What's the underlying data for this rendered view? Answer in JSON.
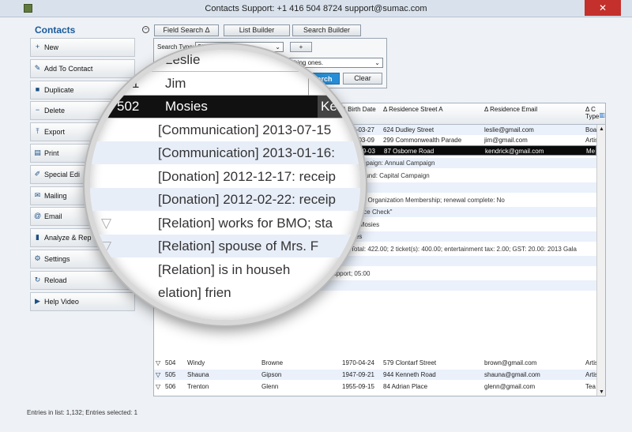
{
  "window": {
    "title": "Contacts      Support: +1 416 504 8724  support@sumac.com",
    "close_label": "✕"
  },
  "sidebar": {
    "title": "Contacts",
    "items": [
      {
        "label": "New",
        "icon": "plus-icon",
        "glyph": "+"
      },
      {
        "label": "Add To Contact",
        "icon": "pencil-icon",
        "glyph": "✎"
      },
      {
        "label": "Duplicate",
        "icon": "duplicate-icon",
        "glyph": "■"
      },
      {
        "label": "Delete",
        "icon": "minus-circle-icon",
        "glyph": "−"
      },
      {
        "label": "Export",
        "icon": "export-icon",
        "glyph": "⤒"
      },
      {
        "label": "Print",
        "icon": "printer-icon",
        "glyph": "▤"
      },
      {
        "label": "Special Edi",
        "icon": "special-edit-icon",
        "glyph": "✐"
      },
      {
        "label": "Mailing",
        "icon": "mailing-icon",
        "glyph": "✉"
      },
      {
        "label": "Email",
        "icon": "email-icon",
        "glyph": "@"
      },
      {
        "label": "Analyze & Rep",
        "icon": "bar-chart-icon",
        "glyph": "▮"
      },
      {
        "label": "Settings",
        "icon": "gear-icon",
        "glyph": "⚙"
      },
      {
        "label": "Reload",
        "icon": "reload-icon",
        "glyph": "↻"
      },
      {
        "label": "Help Video",
        "icon": "video-icon",
        "glyph": "▶"
      }
    ]
  },
  "toolbar": {
    "collapse": "⊖",
    "field_search": "Field Search Δ",
    "list_builder": "List Builder",
    "search_builder": "Search Builder"
  },
  "search": {
    "type_label": "Search Type:",
    "type_value": "Show All",
    "plus": "+",
    "filter_value": "only matching ones.",
    "search_btn": "Search",
    "clear_btn": "Clear"
  },
  "grid": {
    "headers": {
      "birth": "Δ Birth Date",
      "street": "Δ Residence Street A",
      "email": "Δ Residence Email",
      "type": "Δ C Type"
    },
    "top_rows": [
      {
        "birth": "1932-03-27",
        "street": "624 Dudley Street",
        "email": "leslie@gmail.com",
        "type": "Boa"
      },
      {
        "birth": "1937-03-09",
        "street": "299 Commonwealth Parade",
        "email": "jim@gmail.com",
        "type": "Artis"
      },
      {
        "birth": "1951-09-03",
        "street": "87 Osborne Road",
        "email": "kendrick@gmail.com",
        "type": "Me"
      }
    ],
    "sub_rows": [
      "00; Campaign: Annual Campaign",
      "50.00; Fund: Capital Campaign",
      "game",
      "on-Profit Organization Membership; renewal complete: No",
      "on \"Police Check\"",
      "k, Mr. Mosies",
      "mosies",
      "23 Total: 422.00; 2 ticket(s): 400.00; entertainment tax: 2.00; GST: 20.00: 2013 Gala",
      "[Time Docket] 2013-08-27: 02:00",
      "[Time Docket] 2008-09-21 to 2008-09-27: parenting support; 05:00",
      "[Time Docket] 2008-05-13: child care; 07:30"
    ],
    "bottom_rows": [
      {
        "mark": "▽",
        "id": "504",
        "first": "Windy",
        "last": "Browne",
        "birth": "1970-04-24",
        "street": "579 Clontarf Street",
        "email": "brown@gmail.com",
        "type": "Artis"
      },
      {
        "mark": "▽",
        "id": "505",
        "first": "Shauna",
        "last": "Gipson",
        "birth": "1947-09-21",
        "street": "944 Kenneth Road",
        "email": "shauna@gmail.com",
        "type": "Artis"
      },
      {
        "mark": "▽",
        "id": "506",
        "first": "Trenton",
        "last": "Glenn",
        "birth": "1955-09-15",
        "street": "84 Adrian Place",
        "email": "glenn@gmail.com",
        "type": "Tea"
      }
    ]
  },
  "magnifier": {
    "rows": [
      {
        "mark": "",
        "id": "",
        "text": "Leslie"
      },
      {
        "mark": "",
        "id": "501",
        "text": "Jim"
      },
      {
        "mark": "Δ",
        "id": "502",
        "text": "Mosies",
        "extra": "Ke"
      },
      {
        "mark": "",
        "id": "",
        "text": "[Communication] 2013-07-15"
      },
      {
        "mark": "",
        "id": "",
        "text": "[Communication] 2013-01-16:"
      },
      {
        "mark": "",
        "id": "",
        "text": "[Donation] 2012-12-17: receip"
      },
      {
        "mark": "",
        "id": "",
        "text": "[Donation] 2012-02-22: receip"
      },
      {
        "mark": "▽",
        "id": "",
        "text": "[Relation] works for BMO; sta"
      },
      {
        "mark": "▽",
        "id": "",
        "text": "[Relation] spouse of Mrs. F"
      },
      {
        "mark": "",
        "id": "",
        "text": "[Relation] is in househ"
      },
      {
        "mark": "",
        "id": "",
        "text": "elation] frien"
      }
    ]
  },
  "status": "Entries in list: 1,132; Entries selected: 1"
}
